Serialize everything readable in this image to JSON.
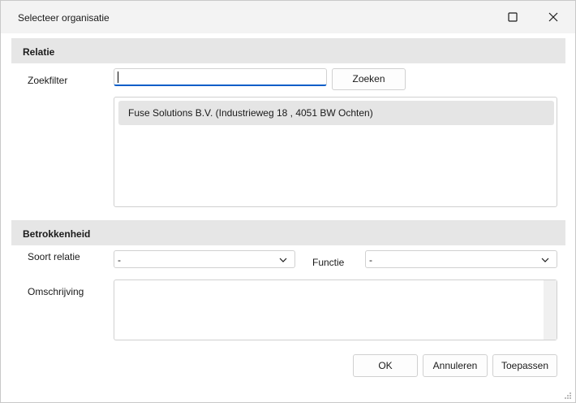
{
  "window": {
    "title": "Selecteer organisatie",
    "icons": [
      "maximize-icon",
      "close-icon"
    ]
  },
  "relatie": {
    "header": "Relatie",
    "zoekfilter_label": "Zoekfilter",
    "zoekfilter_value": "",
    "zoeken_button": "Zoeken",
    "results": [
      "Fuse Solutions B.V. (Industrieweg 18  , 4051 BW Ochten)"
    ]
  },
  "betrokkenheid": {
    "header": "Betrokkenheid",
    "soort_relatie_label": "Soort relatie",
    "soort_relatie_value": "-",
    "functie_label": "Functie",
    "functie_value": "-",
    "omschrijving_label": "Omschrijving",
    "omschrijving_value": ""
  },
  "footer": {
    "ok": "OK",
    "annuleren": "Annuleren",
    "toepassen": "Toepassen"
  }
}
